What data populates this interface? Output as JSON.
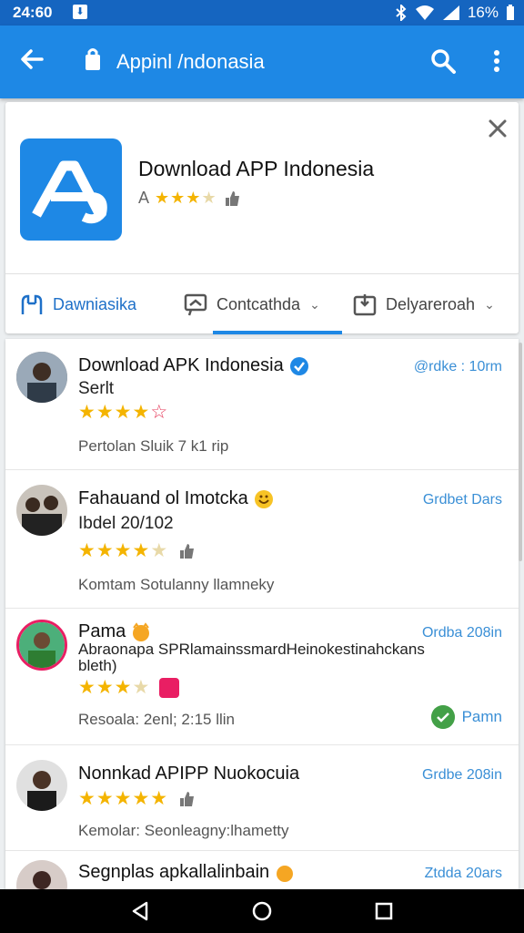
{
  "status": {
    "time": "24:60",
    "battery": "16%"
  },
  "appbar": {
    "title": "Appinl /ndonasia"
  },
  "app": {
    "name": "Download APP Indonesia",
    "rating_prefix": "A",
    "stars": 3
  },
  "tabs": [
    {
      "label": "Dawniasika",
      "icon": "download-icon",
      "active": false
    },
    {
      "label": "Contcathda",
      "icon": "chat-icon",
      "active": true
    },
    {
      "label": "Delyareroah",
      "icon": "upload-icon",
      "active": false
    }
  ],
  "reviews": [
    {
      "name": "Download APK Indonesia",
      "subtitle": "Serlt",
      "date": "@rdke : 10rm",
      "stars": 4,
      "footer": "Pertolan Sluik 7 k1 rip",
      "verified": true
    },
    {
      "name": "Fahauand ol Imotcka",
      "subtitle": "Ibdel 20/102",
      "date": "Grdbet Dars",
      "stars": 4.5,
      "footer": "Komtam Sotulanny llamneky"
    },
    {
      "name": "Pama",
      "subtitle": "Abraonapa SPRlamainssmardHeinokestinahckans bleth)",
      "date": "Ordba 208in",
      "stars": 3.5,
      "footer": "Resoala: 2enl; 2:15 llin",
      "status_label": "Pamn"
    },
    {
      "name": "Nonnkad APIPP Nuokocuia",
      "date": "Grdbe 208in",
      "stars": 5,
      "footer": "Kemolar: Seonleagny:lhametty"
    },
    {
      "name": "Segnplas apkallalinbain",
      "date": "Ztdda 20ars"
    }
  ]
}
